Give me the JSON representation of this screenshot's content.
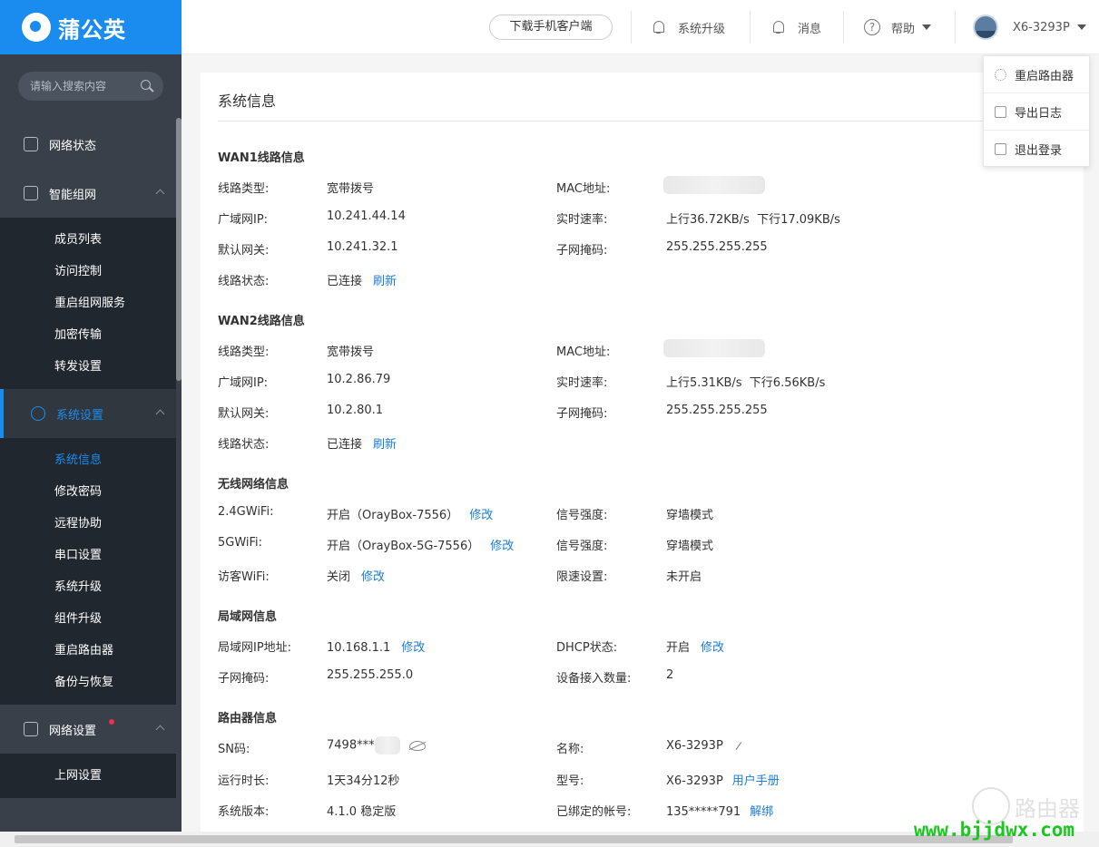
{
  "app": {
    "logo_text": "蒲公英"
  },
  "search": {
    "placeholder": "请输入搜索内容"
  },
  "nav": {
    "net_status": "网络状态",
    "smart_net": "智能组网",
    "smart_net_items": [
      "成员列表",
      "访问控制",
      "重启组网服务",
      "加密传输",
      "转发设置"
    ],
    "system_settings": "系统设置",
    "system_items": [
      "系统信息",
      "修改密码",
      "远程协助",
      "串口设置",
      "系统升级",
      "组件升级",
      "重启路由器",
      "备份与恢复"
    ],
    "network_settings": "网络设置",
    "network_items": [
      "上网设置"
    ]
  },
  "header": {
    "download_btn": "下载手机客户端",
    "upgrade": "系统升级",
    "messages": "消息",
    "help": "帮助",
    "device": "X6-3293P"
  },
  "dropdown": {
    "items": [
      "重启路由器",
      "导出日志",
      "退出登录"
    ]
  },
  "page": {
    "title": "系统信息"
  },
  "wan1": {
    "title": "WAN1线路信息",
    "line_type_label": "线路类型:",
    "line_type": "宽带拨号",
    "mac_label": "MAC地址:",
    "wan_ip_label": "广域网IP:",
    "wan_ip": "10.241.44.14",
    "speed_label": "实时速率:",
    "speed": "上行36.72KB/s  下行17.09KB/s",
    "gateway_label": "默认网关:",
    "gateway": "10.241.32.1",
    "mask_label": "子网掩码:",
    "mask": "255.255.255.255",
    "status_label": "线路状态:",
    "status": "已连接",
    "refresh": "刷新"
  },
  "wan2": {
    "title": "WAN2线路信息",
    "line_type_label": "线路类型:",
    "line_type": "宽带拨号",
    "mac_label": "MAC地址:",
    "wan_ip_label": "广域网IP:",
    "wan_ip": "10.2.86.79",
    "speed_label": "实时速率:",
    "speed": "上行5.31KB/s  下行6.56KB/s",
    "gateway_label": "默认网关:",
    "gateway": "10.2.80.1",
    "mask_label": "子网掩码:",
    "mask": "255.255.255.255",
    "status_label": "线路状态:",
    "status": "已连接",
    "refresh": "刷新"
  },
  "wifi": {
    "title": "无线网络信息",
    "w24_label": "2.4GWiFi:",
    "w24": "开启（OrayBox-7556）",
    "w24_edit": "修改",
    "signal1_label": "信号强度:",
    "signal1": "穿墙模式",
    "w5_label": "5GWiFi:",
    "w5": "开启（OrayBox-5G-7556）",
    "w5_edit": "修改",
    "signal2_label": "信号强度:",
    "signal2": "穿墙模式",
    "guest_label": "访客WiFi:",
    "guest": "关闭",
    "guest_edit": "修改",
    "limit_label": "限速设置:",
    "limit": "未开启"
  },
  "lan": {
    "title": "局域网信息",
    "ip_label": "局域网IP地址:",
    "ip": "10.168.1.1",
    "ip_edit": "修改",
    "dhcp_label": "DHCP状态:",
    "dhcp": "开启",
    "dhcp_edit": "修改",
    "mask_label": "子网掩码:",
    "mask": "255.255.255.0",
    "devices_label": "设备接入数量:",
    "devices": "2"
  },
  "router": {
    "title": "路由器信息",
    "sn_label": "SN码:",
    "sn": "7498***",
    "name_label": "名称:",
    "name": "X6-3293P",
    "uptime_label": "运行时长:",
    "uptime": "1天34分12秒",
    "model_label": "型号:",
    "model": "X6-3293P",
    "manual": "用户手册",
    "version_label": "系统版本:",
    "version": "4.1.0 稳定版",
    "account_label": "已绑定的帐号:",
    "account": "135*****791",
    "unbind": "解绑"
  },
  "watermark": {
    "url": "www.bjjdwx.com",
    "text": "路由器"
  }
}
